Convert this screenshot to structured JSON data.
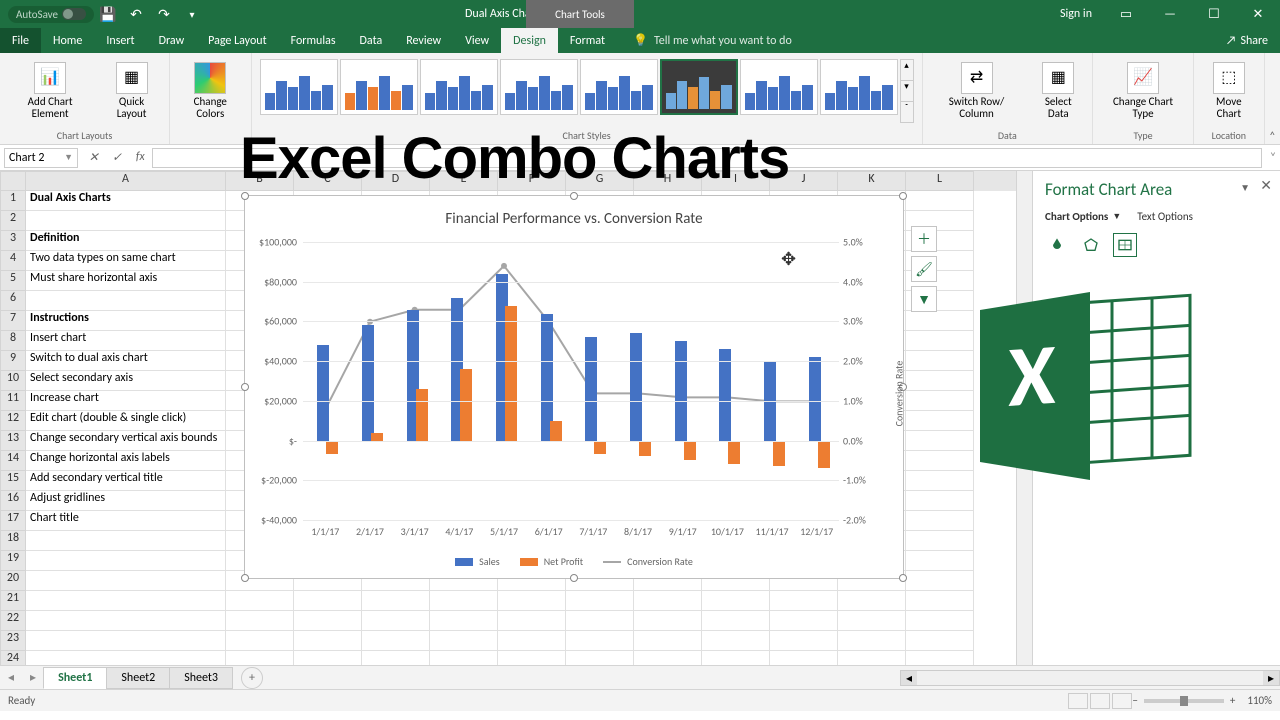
{
  "title_bar": {
    "autosave": "AutoSave",
    "filename": "Dual Axis Charts File  -  Excel",
    "chart_tools": "Chart Tools",
    "sign_in": "Sign in"
  },
  "ribbon_tabs": [
    "File",
    "Home",
    "Insert",
    "Draw",
    "Page Layout",
    "Formulas",
    "Data",
    "Review",
    "View",
    "Design",
    "Format"
  ],
  "tell_me": "Tell me what you want to do",
  "share": "Share",
  "ribbon_groups": {
    "add_chart_element": "Add Chart Element",
    "quick_layout": "Quick Layout",
    "chart_layouts": "Chart Layouts",
    "change_colors": "Change Colors",
    "chart_styles": "Chart Styles",
    "switch_row_col": "Switch Row/ Column",
    "select_data": "Select Data",
    "data": "Data",
    "change_chart_type": "Change Chart Type",
    "type": "Type",
    "move_chart": "Move Chart",
    "location": "Location"
  },
  "name_box": "Chart 2",
  "overlay_title": "Excel Combo Charts",
  "col_headers": [
    "A",
    "B",
    "C",
    "D",
    "E",
    "F",
    "G",
    "H",
    "I",
    "J",
    "K",
    "L"
  ],
  "cells": {
    "1": {
      "A": "Dual Axis Charts",
      "bold": true
    },
    "2": {
      "A": ""
    },
    "3": {
      "A": "Definition",
      "bold": true
    },
    "4": {
      "A": "Two data types on same chart"
    },
    "5": {
      "A": "Must share horizontal axis"
    },
    "6": {
      "A": ""
    },
    "7": {
      "A": "Instructions",
      "bold": true
    },
    "8": {
      "A": "Insert chart"
    },
    "9": {
      "A": "Switch to dual axis chart"
    },
    "10": {
      "A": "Select secondary axis"
    },
    "11": {
      "A": "Increase chart"
    },
    "12": {
      "A": "Edit chart (double & single click)"
    },
    "13": {
      "A": "Change secondary vertical axis bounds"
    },
    "14": {
      "A": "Change horizontal axis labels"
    },
    "15": {
      "A": "Add secondary vertical title"
    },
    "16": {
      "A": "Adjust gridlines"
    },
    "17": {
      "A": "Chart title"
    }
  },
  "chart": {
    "title": "Financial Performance vs. Conversion Rate",
    "y_left_title": "",
    "y_right_title": "Conversion Rate",
    "legend": {
      "sales": "Sales",
      "profit": "Net Profit",
      "conv": "Conversion Rate"
    }
  },
  "chart_data": {
    "type": "bar",
    "title": "Financial Performance vs. Conversion Rate",
    "xlabel": "",
    "ylabel_left": "",
    "ylabel_right": "Conversion Rate",
    "ylim_left": [
      -40000,
      100000
    ],
    "ylim_right": [
      -2.0,
      5.0
    ],
    "y_left_ticks": [
      "$100,000",
      "$80,000",
      "$60,000",
      "$40,000",
      "$20,000",
      "$-",
      "$-20,000",
      "$-40,000"
    ],
    "y_right_ticks": [
      "5.0%",
      "4.0%",
      "3.0%",
      "2.0%",
      "1.0%",
      "0.0%",
      "-1.0%",
      "-2.0%"
    ],
    "categories": [
      "1/1/17",
      "2/1/17",
      "3/1/17",
      "4/1/17",
      "5/1/17",
      "6/1/17",
      "7/1/17",
      "8/1/17",
      "9/1/17",
      "10/1/17",
      "11/1/17",
      "12/1/17"
    ],
    "series": [
      {
        "name": "Sales",
        "type": "bar",
        "axis": "left",
        "color": "#4472c4",
        "values": [
          48000,
          58000,
          66000,
          72000,
          84000,
          64000,
          52000,
          54000,
          50000,
          46000,
          40000,
          42000
        ]
      },
      {
        "name": "Net Profit",
        "type": "bar",
        "axis": "left",
        "color": "#ed7d31",
        "values": [
          -7000,
          4000,
          26000,
          36000,
          68000,
          10000,
          -7000,
          -8000,
          -10000,
          -12000,
          -13000,
          -14000
        ]
      },
      {
        "name": "Conversion Rate",
        "type": "line",
        "axis": "right",
        "color": "#a6a6a6",
        "values": [
          0.8,
          3.0,
          3.3,
          3.3,
          4.4,
          3.0,
          1.2,
          1.2,
          1.1,
          1.1,
          1.0,
          1.0
        ]
      }
    ]
  },
  "format_pane": {
    "title": "Format Chart Area",
    "chart_options": "Chart Options",
    "text_options": "Text Options"
  },
  "sheet_tabs": [
    "Sheet1",
    "Sheet2",
    "Sheet3"
  ],
  "status": {
    "ready": "Ready",
    "zoom": "110%"
  }
}
